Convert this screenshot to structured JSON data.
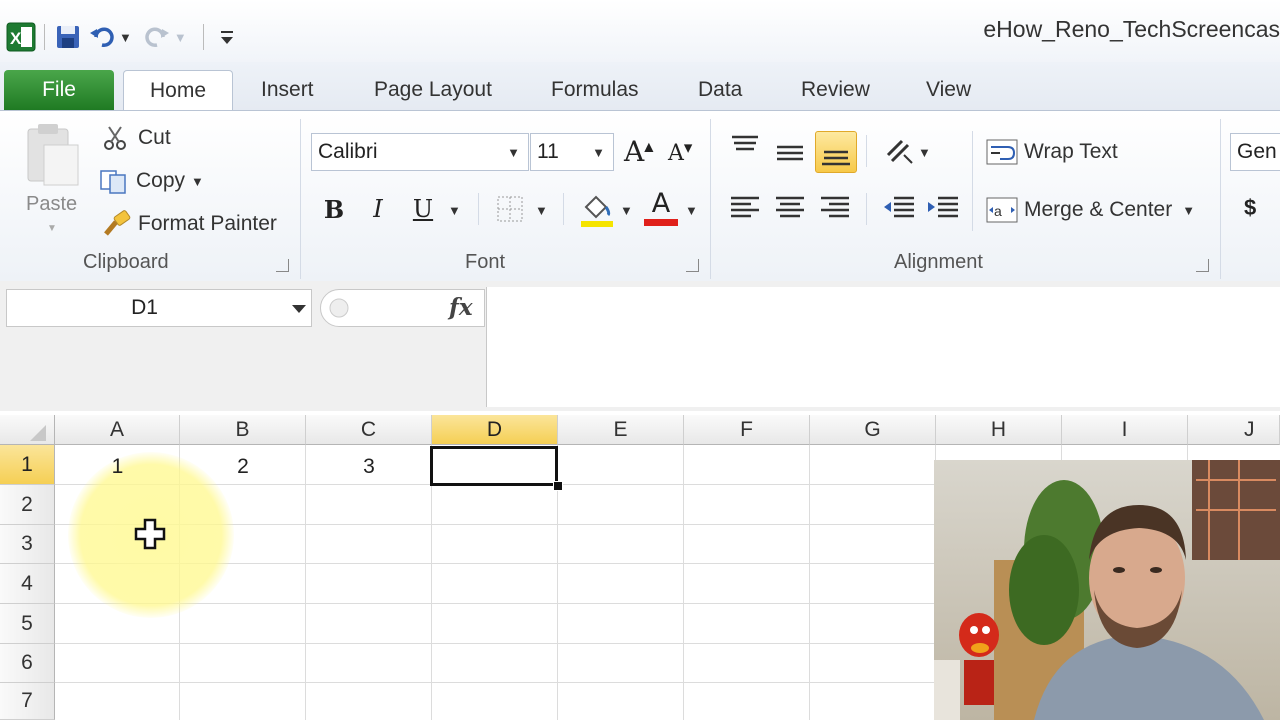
{
  "window": {
    "title": "eHow_Reno_TechScreencas"
  },
  "tabs": [
    "File",
    "Home",
    "Insert",
    "Page Layout",
    "Formulas",
    "Data",
    "Review",
    "View"
  ],
  "clipboard": {
    "paste": "Paste",
    "cut": "Cut",
    "copy": "Copy",
    "format_painter": "Format Painter",
    "group": "Clipboard"
  },
  "font": {
    "name": "Calibri",
    "size": "11",
    "bold": "B",
    "italic": "I",
    "underline": "U",
    "grow": "A",
    "shrink": "A",
    "font_color_glyph": "A",
    "group": "Font"
  },
  "alignment": {
    "wrap_text": "Wrap Text",
    "merge_center": "Merge & Center",
    "group": "Alignment"
  },
  "number": {
    "format": "Gen",
    "currency": "$"
  },
  "formula_bar": {
    "name_box": "D1",
    "fx": "fx",
    "value": ""
  },
  "sheet": {
    "columns": [
      "A",
      "B",
      "C",
      "D",
      "E",
      "F",
      "G",
      "H",
      "I",
      "J"
    ],
    "rows": [
      "1",
      "2",
      "3",
      "4",
      "5",
      "6",
      "7"
    ],
    "cells": {
      "A1": "1",
      "B1": "2",
      "C1": "3"
    },
    "active_cell": "D1"
  },
  "colors": {
    "file_tab": "#2d8a31",
    "selection_header": "#f5cf54",
    "cursor_highlight": "#fff59a",
    "font_color_bar": "#e0201b",
    "fill_color_bar": "#f5e400"
  }
}
